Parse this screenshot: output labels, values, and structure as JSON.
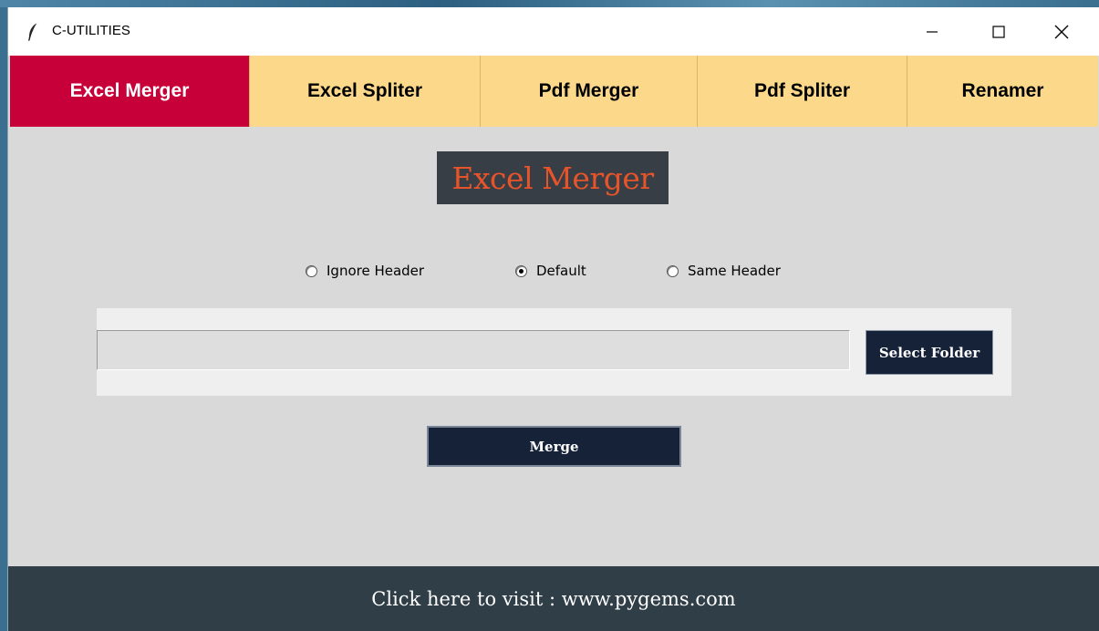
{
  "window": {
    "title": "C-UTILITIES"
  },
  "tabs": [
    {
      "label": "Excel Merger",
      "active": true
    },
    {
      "label": "Excel Spliter",
      "active": false
    },
    {
      "label": "Pdf Merger",
      "active": false
    },
    {
      "label": "Pdf Spliter",
      "active": false
    },
    {
      "label": "Renamer",
      "active": false
    }
  ],
  "main": {
    "heading": "Excel Merger",
    "radio_options": [
      {
        "label": "Ignore Header",
        "selected": false
      },
      {
        "label": "Default",
        "selected": true
      },
      {
        "label": "Same Header",
        "selected": false
      }
    ],
    "folder_path_value": "",
    "select_folder_label": "Select Folder",
    "merge_label": "Merge"
  },
  "footer": {
    "link_text": "Click here to visit : www.pygems.com"
  },
  "colors": {
    "active_tab": "#c8003a",
    "inactive_tab": "#fcd88a",
    "heading_bg": "#373e46",
    "heading_text": "#e8542a",
    "button_bg": "#162238",
    "footer_bg": "#2f3e47"
  },
  "icons": {
    "app": "feather-icon",
    "minimize": "minimize-icon",
    "maximize": "maximize-icon",
    "close": "close-icon"
  }
}
